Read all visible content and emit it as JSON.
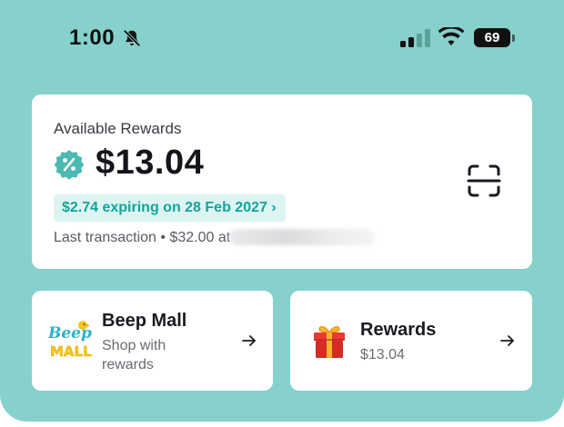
{
  "status_bar": {
    "time": "1:00",
    "battery": "69",
    "icons": [
      "bell-off-icon",
      "signal-icon",
      "wifi-icon",
      "battery-icon"
    ]
  },
  "rewards_card": {
    "title": "Available Rewards",
    "amount": "$13.04",
    "expiry": "$2.74 expiring on 28 Feb 2027 ›",
    "last_transaction": "Last transaction • $32.00 at",
    "icons": [
      "percent-badge-icon",
      "scan-icon"
    ]
  },
  "mall_card": {
    "title": "Beep Mall",
    "subtitle_line1": "Shop with",
    "subtitle_line2": "rewards",
    "logo_text": "Beep MALL"
  },
  "rewards_tile": {
    "title": "Rewards",
    "amount": "$13.04"
  },
  "colors": {
    "background_teal": "#86d1cb",
    "accent_teal": "#11a59a",
    "pill_bg": "#def4f2",
    "card_bg": "#ffffff",
    "gift_red": "#e0342c",
    "gift_ribbon": "#f7b52c"
  }
}
